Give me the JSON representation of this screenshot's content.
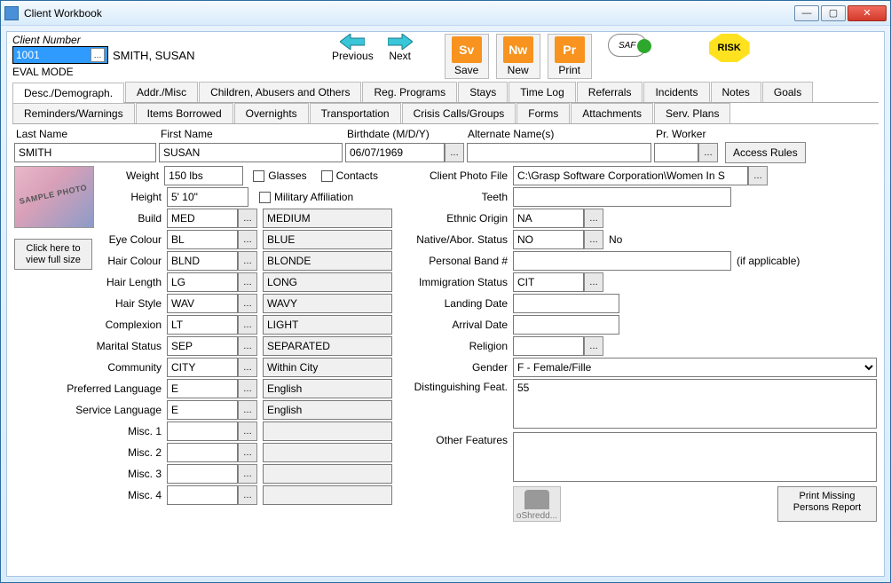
{
  "window": {
    "title": "Client Workbook"
  },
  "client": {
    "number_label": "Client Number",
    "number": "1001",
    "name": "SMITH, SUSAN",
    "eval_mode": "EVAL MODE"
  },
  "nav": {
    "prev": "Previous",
    "next": "Next"
  },
  "actions": {
    "save": {
      "code": "Sv",
      "label": "Save"
    },
    "new": {
      "code": "Nw",
      "label": "New"
    },
    "print": {
      "code": "Pr",
      "label": "Print"
    }
  },
  "badges": {
    "saf": "SAF",
    "risk": "RISK"
  },
  "tabs_row1": [
    "Desc./Demograph.",
    "Addr./Misc",
    "Children, Abusers and Others",
    "Reg. Programs",
    "Stays",
    "Time Log",
    "Referrals",
    "Incidents",
    "Notes",
    "Goals"
  ],
  "tabs_row2": [
    "Reminders/Warnings",
    "Items Borrowed",
    "Overnights",
    "Transportation",
    "Crisis Calls/Groups",
    "Forms",
    "Attachments",
    "Serv. Plans"
  ],
  "header": {
    "last_name_label": "Last Name",
    "last_name": "SMITH",
    "first_name_label": "First Name",
    "first_name": "SUSAN",
    "birthdate_label": "Birthdate (M/D/Y)",
    "birthdate": "06/07/1969",
    "alt_name_label": "Alternate Name(s)",
    "alt_name": "",
    "pr_worker_label": "Pr. Worker",
    "pr_worker": "",
    "access_rules": "Access Rules"
  },
  "photo_btn": "Click here to view full size",
  "left_top": {
    "weight_label": "Weight",
    "weight": "150 lbs",
    "height_label": "Height",
    "height": "5' 10\"",
    "glasses": "Glasses",
    "contacts": "Contacts",
    "military": "Military Affiliation"
  },
  "left": [
    {
      "label": "Build",
      "code": "MED",
      "desc": "MEDIUM"
    },
    {
      "label": "Eye Colour",
      "code": "BL",
      "desc": "BLUE"
    },
    {
      "label": "Hair Colour",
      "code": "BLND",
      "desc": "BLONDE"
    },
    {
      "label": "Hair Length",
      "code": "LG",
      "desc": "LONG"
    },
    {
      "label": "Hair Style",
      "code": "WAV",
      "desc": "WAVY"
    },
    {
      "label": "Complexion",
      "code": "LT",
      "desc": "LIGHT"
    },
    {
      "label": "Marital Status",
      "code": "SEP",
      "desc": "SEPARATED"
    },
    {
      "label": "Community",
      "code": "CITY",
      "desc": "Within City"
    },
    {
      "label": "Preferred Language",
      "code": "E",
      "desc": "English"
    },
    {
      "label": "Service Language",
      "code": "E",
      "desc": "English"
    },
    {
      "label": "Misc. 1",
      "code": "",
      "desc": ""
    },
    {
      "label": "Misc. 2",
      "code": "",
      "desc": ""
    },
    {
      "label": "Misc. 3",
      "code": "",
      "desc": ""
    },
    {
      "label": "Misc. 4",
      "code": "",
      "desc": ""
    }
  ],
  "right": {
    "photo_file_label": "Client Photo File",
    "photo_file": "C:\\Grasp Software Corporation\\Women In S",
    "teeth_label": "Teeth",
    "teeth": "",
    "ethnic_label": "Ethnic Origin",
    "ethnic": "NA",
    "native_label": "Native/Abor. Status",
    "native_code": "NO",
    "native_desc": "No",
    "band_label": "Personal Band #",
    "band": "",
    "band_note": "(if applicable)",
    "imm_label": "Immigration Status",
    "imm": "CIT",
    "landing_label": "Landing Date",
    "landing": "",
    "arrival_label": "Arrival Date",
    "arrival": "",
    "religion_label": "Religion",
    "religion": "",
    "gender_label": "Gender",
    "gender": "F - Female/Fille",
    "dist_label": "Distinguishing Feat.",
    "dist": "55",
    "other_label": "Other Features",
    "other": "",
    "shredd": "oShredd...",
    "print_missing": "Print Missing Persons Report"
  }
}
